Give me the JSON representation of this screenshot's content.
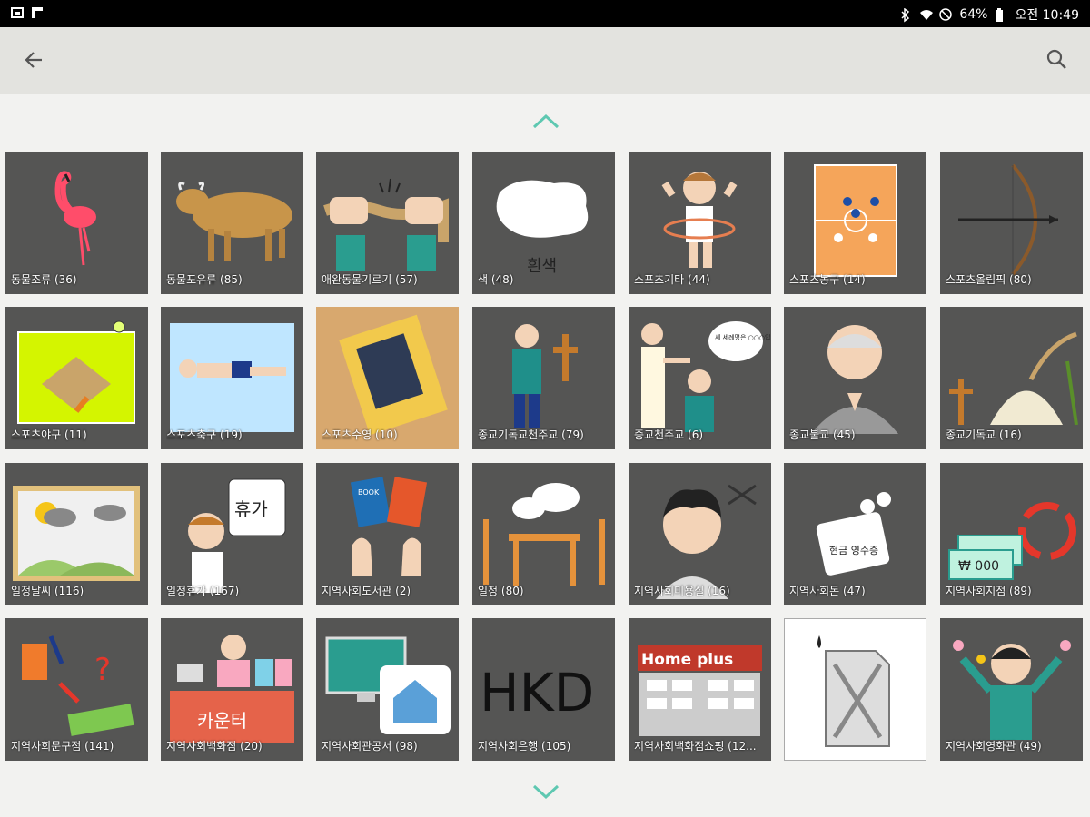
{
  "status": {
    "battery": "64%",
    "time": "오전 10:49"
  },
  "colors": {
    "accent": "#5ec8b1",
    "tile_bg": "#555554"
  },
  "tiles": [
    {
      "label": "동물조류 (36)"
    },
    {
      "label": "동물포유류 (85)"
    },
    {
      "label": "애완동물기르기 (57)"
    },
    {
      "label": "색 (48)",
      "inner_text": "흰색"
    },
    {
      "label": "스포츠기타 (44)"
    },
    {
      "label": "스포츠농구 (14)"
    },
    {
      "label": "스포츠올림픽 (80)"
    },
    {
      "label": "스포츠야구 (11)"
    },
    {
      "label": "스포츠축구 (19)"
    },
    {
      "label": "스포츠수영 (10)"
    },
    {
      "label": "종교기독교천주교 (79)"
    },
    {
      "label": "종교천주교 (6)",
      "inner_text": "세 세례명은 ○○○입니다."
    },
    {
      "label": "종교불교 (45)"
    },
    {
      "label": "종교기독교 (16)"
    },
    {
      "label": "일정날씨 (116)"
    },
    {
      "label": "일정휴가 (167)",
      "inner_text": "휴가"
    },
    {
      "label": "지역사회도서관 (2)",
      "inner_text": "BOOK"
    },
    {
      "label": "일정 (80)"
    },
    {
      "label": "지역사회미용실 (16)"
    },
    {
      "label": "지역사회돈 (47)",
      "inner_text": "현금 영수증"
    },
    {
      "label": "지역사회지점 (89)",
      "inner_text": "₩ 000"
    },
    {
      "label": "지역사회문구점 (141)"
    },
    {
      "label": "지역사회백화점 (20)",
      "inner_text": "카운터"
    },
    {
      "label": "지역사회관공서 (98)"
    },
    {
      "label": "지역사회은행 (105)",
      "inner_text": "HKD"
    },
    {
      "label": "지역사회백화점쇼핑 (12...",
      "inner_text": "Home plus"
    },
    {
      "label": ""
    },
    {
      "label": "지역사회영화관 (49)"
    }
  ]
}
